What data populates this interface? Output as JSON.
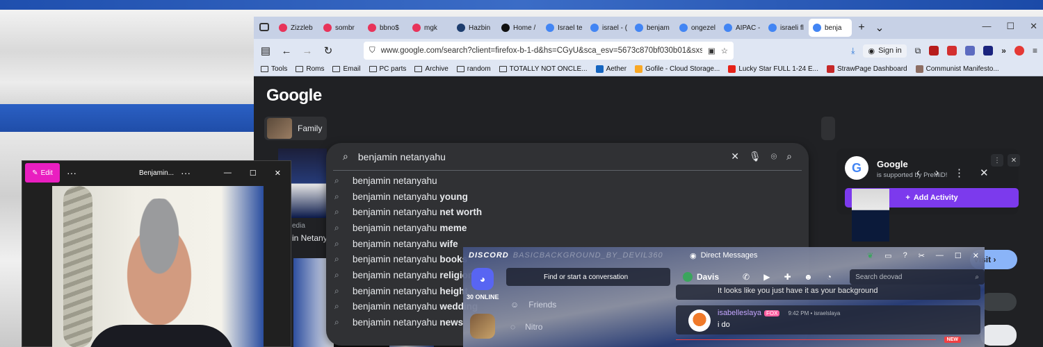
{
  "browser": {
    "tabs": [
      {
        "label": "Zizzleb",
        "color": "#e8335a"
      },
      {
        "label": "sombr",
        "color": "#e8335a"
      },
      {
        "label": "bbno$",
        "color": "#e8335a"
      },
      {
        "label": "mgk",
        "color": "#e8335a"
      },
      {
        "label": "Hazbin",
        "color": "#1d3d6e"
      },
      {
        "label": "Home /",
        "color": "#111111"
      },
      {
        "label": "Israel te",
        "color": "#4285f4"
      },
      {
        "label": "israel - (",
        "color": "#4285f4"
      },
      {
        "label": "benjam",
        "color": "#4285f4"
      },
      {
        "label": "ongezel",
        "color": "#4285f4"
      },
      {
        "label": "AIPAC -",
        "color": "#4285f4"
      },
      {
        "label": "israeli fl",
        "color": "#4285f4"
      },
      {
        "label": "benja",
        "color": "#4285f4"
      }
    ],
    "url": "www.google.com/search?client=firefox-b-1-d&hs=CGyU&sca_esv=5673c870bf030b01&sxsrf=AI",
    "signin_label": "Sign in",
    "bookmarks": [
      {
        "label": "Tools",
        "kind": "folder"
      },
      {
        "label": "Roms",
        "kind": "folder"
      },
      {
        "label": "Email",
        "kind": "folder"
      },
      {
        "label": "PC parts",
        "kind": "folder"
      },
      {
        "label": "Archive",
        "kind": "folder"
      },
      {
        "label": "random",
        "kind": "folder"
      },
      {
        "label": "TOTALLY NOT ONCLE...",
        "kind": "folder"
      },
      {
        "label": "Aether",
        "kind": "site",
        "color": "#1565c0"
      },
      {
        "label": "Gofile - Cloud Storage...",
        "kind": "site",
        "color": "#f9a825"
      },
      {
        "label": "Lucky Star FULL 1-24 E...",
        "kind": "site",
        "color": "#e62117"
      },
      {
        "label": "StrawPage Dashboard",
        "kind": "site",
        "color": "#c62828"
      },
      {
        "label": "Communist Manifesto...",
        "kind": "site",
        "color": "#8d6e63"
      }
    ]
  },
  "google": {
    "logo": "Google",
    "query": "benjamin netanyahu",
    "chip_family": "Family",
    "result_source": "edia",
    "result_title": "in Netany",
    "suggestions": [
      {
        "base": "benjamin netanyahu",
        "bold": ""
      },
      {
        "base": "benjamin netanyahu ",
        "bold": "young"
      },
      {
        "base": "benjamin netanyahu ",
        "bold": "net worth"
      },
      {
        "base": "benjamin netanyahu ",
        "bold": "meme"
      },
      {
        "base": "benjamin netanyahu ",
        "bold": "wife"
      },
      {
        "base": "benjamin netanyahu ",
        "bold": "books"
      },
      {
        "base": "benjamin netanyahu ",
        "bold": "religion"
      },
      {
        "base": "benjamin netanyahu ",
        "bold": "height"
      },
      {
        "base": "benjamin netanyahu ",
        "bold": "wedding"
      },
      {
        "base": "benjamin netanyahu ",
        "bold": "news"
      }
    ],
    "visit_label": "Visit",
    "premid": {
      "title": "Google",
      "subtitle": "is supported by PreMiD!",
      "button": "Add Activity",
      "accent": "#7c3aed"
    }
  },
  "photos": {
    "edit_label": "Edit",
    "title": "Benjamin...",
    "accent": "#e91ec0"
  },
  "discord": {
    "brand": "DISCORD",
    "brand_ghost": "BASICBACKGROUND_BY_DEVIL360",
    "window_title": "Direct Messages",
    "online_count": "30 ONLINE",
    "find_placeholder": "Find or start a conversation",
    "friends": "Friends",
    "nitro": "Nitro",
    "dm_user": "Davis",
    "search_placeholder": "Search deovad",
    "message_prev": "It looks like you just have it as your background",
    "msg_author": "isabelleslaya",
    "msg_tag": "FOX",
    "msg_time": "9:42 PM • israelslaya",
    "msg_text": "i do",
    "new_badge": "NEW",
    "accent": "#5865f2"
  }
}
